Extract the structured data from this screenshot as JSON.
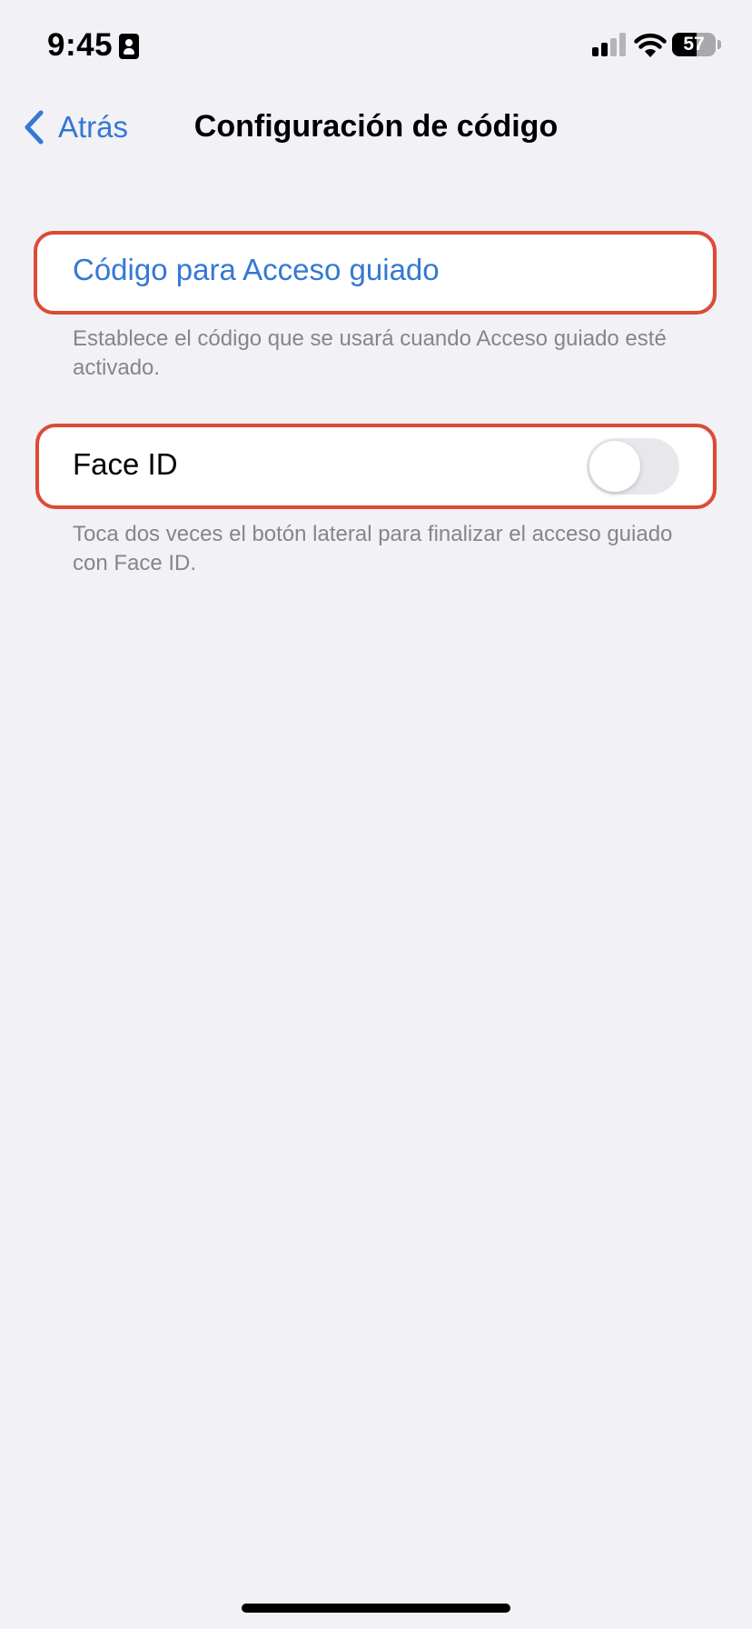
{
  "status_bar": {
    "time": "9:45",
    "battery_percent": "57",
    "battery_level": 0.57,
    "signal_bars_active": 2,
    "signal_bars_total": 4
  },
  "nav": {
    "back_label": "Atrás",
    "title": "Configuración de código"
  },
  "passcode_section": {
    "row_label": "Código para Acceso guiado",
    "footer": "Establece el código que se usará cuando Acceso guiado esté activado."
  },
  "faceid_section": {
    "row_label": "Face ID",
    "toggle_on": false,
    "footer": "Toca dos veces el botón lateral para finalizar el acceso guiado con Face ID."
  },
  "colors": {
    "accent": "#3478d4",
    "highlight": "#dd4a35",
    "background": "#f1f1f6",
    "footer_text": "#85858b"
  },
  "icons": {
    "back": "chevron-left-icon",
    "status_id": "id-badge-icon",
    "signal": "cellular-signal-icon",
    "wifi": "wifi-icon",
    "battery": "battery-icon"
  }
}
